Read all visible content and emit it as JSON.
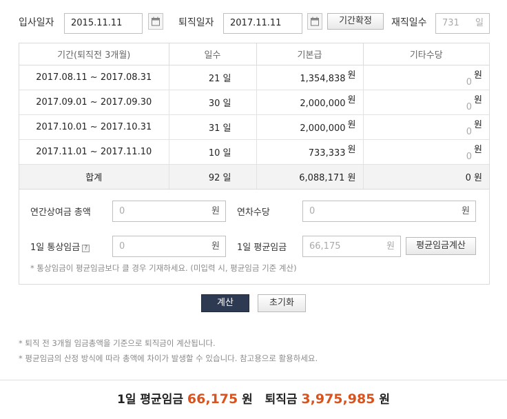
{
  "top": {
    "join_label": "입사일자",
    "join_value": "2015.11.11",
    "leave_label": "퇴직일자",
    "leave_value": "2017.11.11",
    "confirm_button": "기간확정",
    "tenure_label": "재직일수",
    "tenure_value": "731",
    "tenure_unit": "일"
  },
  "table": {
    "headers": [
      "기간(퇴직전 3개월)",
      "일수",
      "기본급",
      "기타수당"
    ],
    "rows": [
      {
        "period": "2017.08.11 ~ 2017.08.31",
        "days": "21",
        "base": "1,354,838",
        "other": "0"
      },
      {
        "period": "2017.09.01 ~ 2017.09.30",
        "days": "30",
        "base": "2,000,000",
        "other": "0"
      },
      {
        "period": "2017.10.01 ~ 2017.10.31",
        "days": "31",
        "base": "2,000,000",
        "other": "0"
      },
      {
        "period": "2017.11.01 ~ 2017.11.10",
        "days": "10",
        "base": "733,333",
        "other": "0"
      }
    ],
    "sum": {
      "label": "합계",
      "days": "92",
      "base": "6,088,171",
      "other": "0"
    },
    "day_unit": "일",
    "won_unit": "원"
  },
  "form": {
    "annual_bonus_label": "연간상여금 총액",
    "annual_bonus_value": "0",
    "annual_leave_label": "연차수당",
    "annual_leave_value": "0",
    "daily_ordinary_label": "1일 통상임금",
    "daily_ordinary_help": "?",
    "daily_ordinary_value": "0",
    "daily_avg_label": "1일 평균임금",
    "daily_avg_value": "66,175",
    "avg_calc_button": "평균임금계산",
    "note": "* 통상임금이 평균임금보다 클 경우 기재하세요. (미입력 시, 평균임금 기준 계산)",
    "won_unit": "원"
  },
  "actions": {
    "calc": "계산",
    "reset": "초기화"
  },
  "notes": [
    "* 퇴직 전 3개월 임금총액을 기준으로 퇴직금이 계산됩니다.",
    "* 평균임금의 산정 방식에 따라 총액에 차이가 발생할 수 있습니다. 참고용으로 활용하세요."
  ],
  "result": {
    "avg_label": "1일 평균임금",
    "avg_value": "66,175",
    "won": "원",
    "severance_label": "퇴직금",
    "severance_value": "3,975,985"
  }
}
